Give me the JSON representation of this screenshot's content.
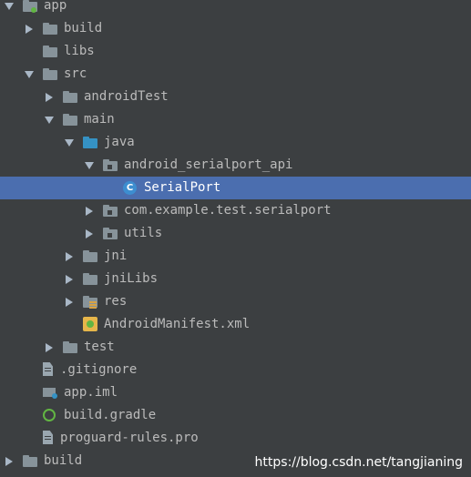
{
  "tree": [
    {
      "label": "app",
      "indent": 0,
      "arrow": "expanded",
      "icon": "module-folder-icon"
    },
    {
      "label": "build",
      "indent": 1,
      "arrow": "collapsed",
      "icon": "folder-icon"
    },
    {
      "label": "libs",
      "indent": 1,
      "arrow": "none",
      "icon": "folder-icon"
    },
    {
      "label": "src",
      "indent": 1,
      "arrow": "expanded",
      "icon": "folder-icon"
    },
    {
      "label": "androidTest",
      "indent": 2,
      "arrow": "collapsed",
      "icon": "folder-icon"
    },
    {
      "label": "main",
      "indent": 2,
      "arrow": "expanded",
      "icon": "folder-icon"
    },
    {
      "label": "java",
      "indent": 3,
      "arrow": "expanded",
      "icon": "source-folder-icon"
    },
    {
      "label": "android_serialport_api",
      "indent": 4,
      "arrow": "expanded",
      "icon": "package-icon"
    },
    {
      "label": "SerialPort",
      "indent": 5,
      "arrow": "none",
      "icon": "class-icon",
      "selected": true
    },
    {
      "label": "com.example.test.serialport",
      "indent": 4,
      "arrow": "collapsed",
      "icon": "package-icon"
    },
    {
      "label": "utils",
      "indent": 4,
      "arrow": "collapsed",
      "icon": "package-icon"
    },
    {
      "label": "jni",
      "indent": 3,
      "arrow": "collapsed",
      "icon": "folder-icon"
    },
    {
      "label": "jniLibs",
      "indent": 3,
      "arrow": "collapsed",
      "icon": "folder-icon"
    },
    {
      "label": "res",
      "indent": 3,
      "arrow": "collapsed",
      "icon": "resource-folder-icon"
    },
    {
      "label": "AndroidManifest.xml",
      "indent": 3,
      "arrow": "none",
      "icon": "manifest-xml-icon"
    },
    {
      "label": "test",
      "indent": 2,
      "arrow": "collapsed",
      "icon": "folder-icon"
    },
    {
      "label": ".gitignore",
      "indent": 1,
      "arrow": "none",
      "icon": "text-file-icon"
    },
    {
      "label": "app.iml",
      "indent": 1,
      "arrow": "none",
      "icon": "iml-file-icon"
    },
    {
      "label": "build.gradle",
      "indent": 1,
      "arrow": "none",
      "icon": "gradle-icon"
    },
    {
      "label": "proguard-rules.pro",
      "indent": 1,
      "arrow": "none",
      "icon": "text-file-icon"
    },
    {
      "label": "build",
      "indent": 0,
      "arrow": "collapsed",
      "icon": "folder-icon"
    }
  ],
  "class_icon_letter": "C",
  "watermark": "https://blog.csdn.net/tangjianing",
  "colors": {
    "background": "#3c3f41",
    "selection": "#4b6eaf",
    "text": "#bbbbbb",
    "folder": "#87939a",
    "source_folder": "#3592c4",
    "class_icon": "#3d8ed0"
  }
}
